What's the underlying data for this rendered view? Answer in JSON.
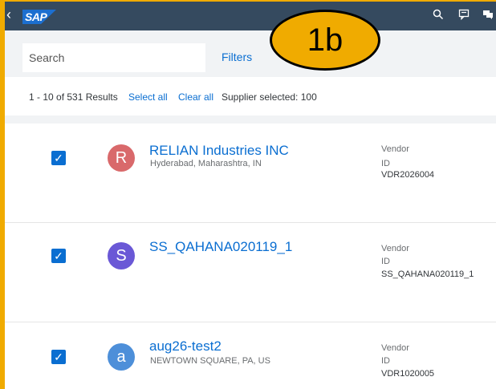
{
  "shell": {
    "logo": "SAP",
    "back_icon": "‹"
  },
  "callout": {
    "label": "1b"
  },
  "search": {
    "placeholder": "Search"
  },
  "toolbar": {
    "filters_label": "Filters"
  },
  "results": {
    "count_text": "1 - 10 of 531 Results",
    "select_all": "Select all",
    "clear_all": "Clear all",
    "supplier_selected": "Supplier selected: 100"
  },
  "suppliers": [
    {
      "initial": "R",
      "name": "RELIAN Industries INC",
      "location": "Hyderabad, Maharashtra, IN",
      "type_label": "Vendor",
      "id_label": "ID",
      "id_value": "VDR2026004",
      "avatar_color": "#d9696b"
    },
    {
      "initial": "S",
      "name": "SS_QAHANA020119_1",
      "location": "",
      "type_label": "Vendor",
      "id_label": "ID",
      "id_value": "SS_QAHANA020119_1",
      "avatar_color": "#6a58d6"
    },
    {
      "initial": "a",
      "name": "aug26-test2",
      "location": "NEWTOWN SQUARE, PA, US",
      "type_label": "Vendor",
      "id_label": "ID",
      "id_value": "VDR1020005",
      "avatar_color": "#4d8fd9"
    }
  ],
  "colors": {
    "accent": "#0a6ed1",
    "shell": "#354a5f",
    "highlight": "#f0ab00"
  }
}
